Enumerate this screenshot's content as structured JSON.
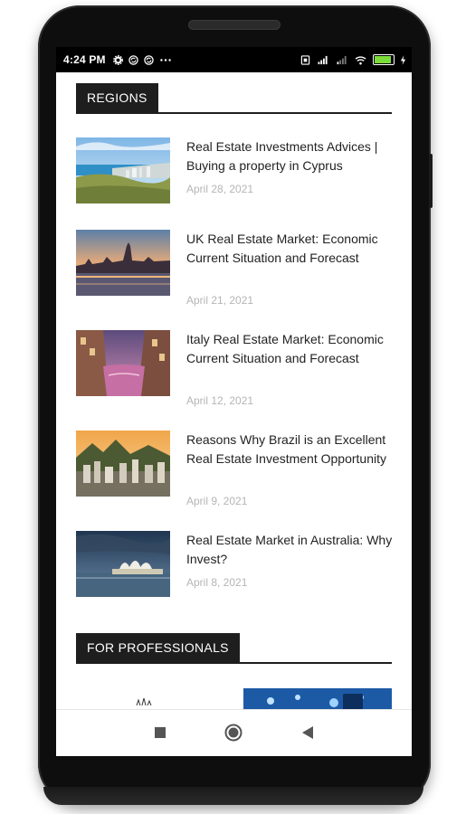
{
  "status_bar": {
    "time": "4:24 PM",
    "left_icons": [
      "settings-icon",
      "sync-icon",
      "sync-icon",
      "more-dots-icon"
    ],
    "right_icons": [
      "sim-icon",
      "signal-icon",
      "signal-weak-icon",
      "wifi-icon",
      "battery-icon",
      "charging-icon"
    ],
    "battery_level": 0.8
  },
  "sections": {
    "regions": {
      "title": "REGIONS",
      "posts": [
        {
          "title": "Real Estate Investments Advices | Buying a property in Cyprus",
          "date": "April 28, 2021",
          "image": "cyprus-coast-image"
        },
        {
          "title": "UK Real Estate Market: Economic Current Situation and Forecast",
          "date": "April 21, 2021",
          "image": "london-skyline-image"
        },
        {
          "title": "Italy Real Estate Market: Economic Current Situation and Forecast",
          "date": "April 12, 2021",
          "image": "venice-canal-image"
        },
        {
          "title": "Reasons Why Brazil is an Excellent Real Estate Investment Opportunity",
          "date": "April 9, 2021",
          "image": "rio-city-image"
        },
        {
          "title": "Real Estate Market in Australia: Why Invest?",
          "date": "April 8, 2021",
          "image": "sydney-opera-house-image"
        }
      ]
    },
    "professionals": {
      "title": "FOR PROFESSIONALS"
    }
  },
  "nav_bar": {
    "items": [
      "recents-square-icon",
      "home-circle-icon",
      "back-triangle-icon"
    ]
  },
  "colors": {
    "section_tag_bg": "#1e1e1e",
    "date_text": "#b5b5b5",
    "title_text": "#222222"
  }
}
